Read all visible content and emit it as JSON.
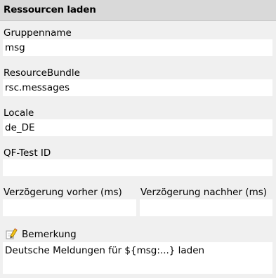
{
  "header": {
    "title": "Ressourcen laden"
  },
  "fields": {
    "group_name": {
      "label": "Gruppenname",
      "value": "msg"
    },
    "resource_bundle": {
      "label": "ResourceBundle",
      "value": "rsc.messages"
    },
    "locale": {
      "label": "Locale",
      "value": "de_DE"
    },
    "qftest_id": {
      "label": "QF-Test ID",
      "value": ""
    },
    "delay_before": {
      "label": "Verzögerung vorher (ms)",
      "value": ""
    },
    "delay_after": {
      "label": "Verzögerung nachher (ms)",
      "value": ""
    }
  },
  "remark": {
    "label": "Bemerkung",
    "icon": "pencil-note-icon",
    "value": "Deutsche Meldungen für ${msg:...} laden"
  }
}
